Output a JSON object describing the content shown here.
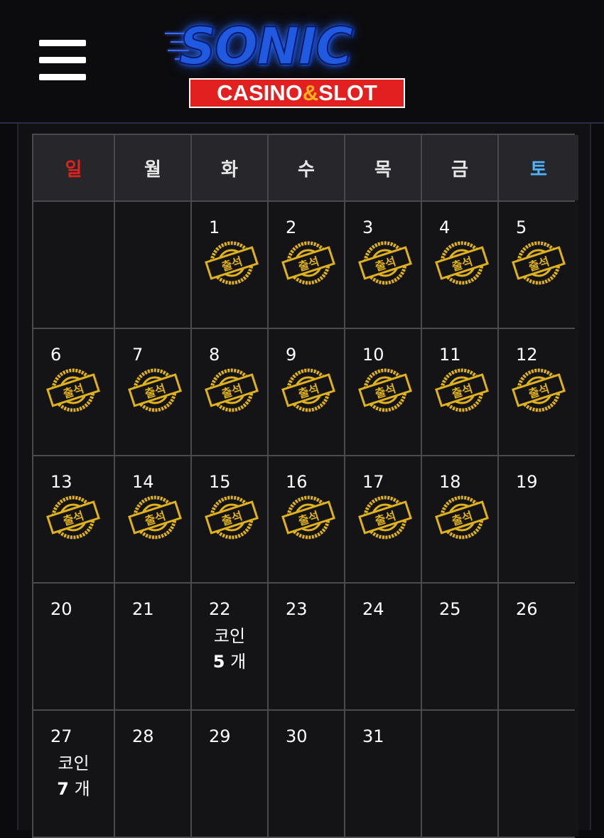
{
  "header": {
    "logo_title": "SONIC",
    "logo_sub_left": "CASINO",
    "logo_sub_amp": "&",
    "logo_sub_right": "SLOT"
  },
  "weekdays": [
    "일",
    "월",
    "화",
    "수",
    "목",
    "금",
    "토"
  ],
  "stamp_label": "출석",
  "coin_label": "코인",
  "coin_unit": "개",
  "days": [
    {
      "day": "",
      "stamp": false
    },
    {
      "day": "",
      "stamp": false
    },
    {
      "day": "1",
      "stamp": true
    },
    {
      "day": "2",
      "stamp": true
    },
    {
      "day": "3",
      "stamp": true
    },
    {
      "day": "4",
      "stamp": true
    },
    {
      "day": "5",
      "stamp": true
    },
    {
      "day": "6",
      "stamp": true
    },
    {
      "day": "7",
      "stamp": true
    },
    {
      "day": "8",
      "stamp": true
    },
    {
      "day": "9",
      "stamp": true
    },
    {
      "day": "10",
      "stamp": true
    },
    {
      "day": "11",
      "stamp": true
    },
    {
      "day": "12",
      "stamp": true
    },
    {
      "day": "13",
      "stamp": true
    },
    {
      "day": "14",
      "stamp": true
    },
    {
      "day": "15",
      "stamp": true
    },
    {
      "day": "16",
      "stamp": true
    },
    {
      "day": "17",
      "stamp": true
    },
    {
      "day": "18",
      "stamp": true
    },
    {
      "day": "19",
      "stamp": false
    },
    {
      "day": "20",
      "stamp": false
    },
    {
      "day": "21",
      "stamp": false
    },
    {
      "day": "22",
      "stamp": false,
      "coins": "5"
    },
    {
      "day": "23",
      "stamp": false
    },
    {
      "day": "24",
      "stamp": false
    },
    {
      "day": "25",
      "stamp": false
    },
    {
      "day": "26",
      "stamp": false
    },
    {
      "day": "27",
      "stamp": false,
      "coins": "7"
    },
    {
      "day": "28",
      "stamp": false
    },
    {
      "day": "29",
      "stamp": false
    },
    {
      "day": "30",
      "stamp": false
    },
    {
      "day": "31",
      "stamp": false
    },
    {
      "day": "",
      "stamp": false
    },
    {
      "day": "",
      "stamp": false
    }
  ],
  "colors": {
    "sunday": "#e0221e",
    "saturday": "#4fb3ff",
    "stamp_gold": "#e0b21a"
  }
}
